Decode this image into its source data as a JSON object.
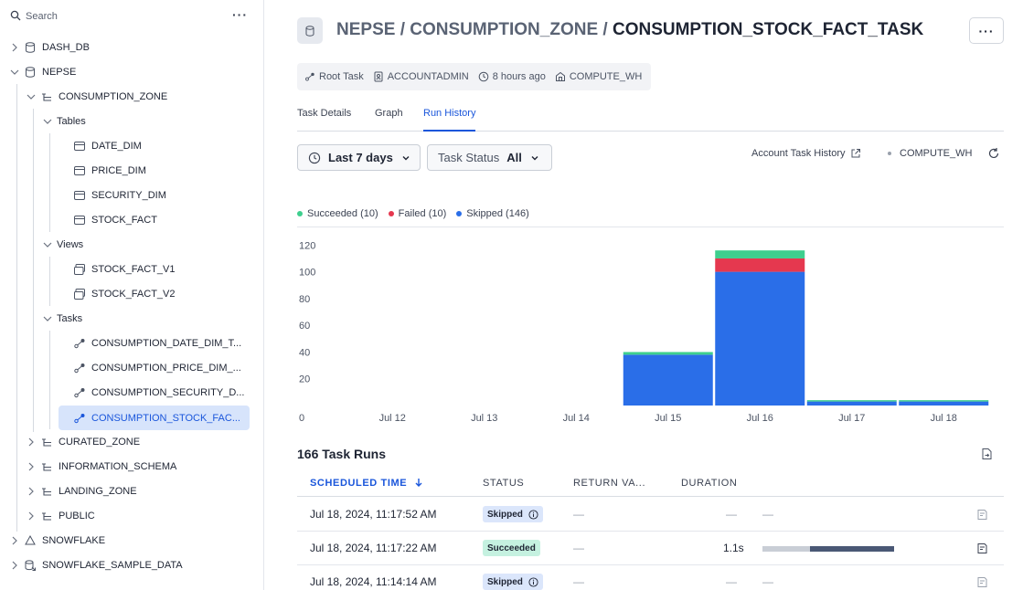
{
  "sidebar": {
    "search_placeholder": "Search",
    "more_label": "···",
    "items": [
      {
        "label": "DASH_DB"
      },
      {
        "label": "NEPSE"
      },
      {
        "label": "CONSUMPTION_ZONE"
      },
      {
        "label": "Tables"
      },
      {
        "label": "DATE_DIM"
      },
      {
        "label": "PRICE_DIM"
      },
      {
        "label": "SECURITY_DIM"
      },
      {
        "label": "STOCK_FACT"
      },
      {
        "label": "Views"
      },
      {
        "label": "STOCK_FACT_V1"
      },
      {
        "label": "STOCK_FACT_V2"
      },
      {
        "label": "Tasks"
      },
      {
        "label": "CONSUMPTION_DATE_DIM_T..."
      },
      {
        "label": "CONSUMPTION_PRICE_DIM_..."
      },
      {
        "label": "CONSUMPTION_SECURITY_D..."
      },
      {
        "label": "CONSUMPTION_STOCK_FAC..."
      },
      {
        "label": "CURATED_ZONE"
      },
      {
        "label": "INFORMATION_SCHEMA"
      },
      {
        "label": "LANDING_ZONE"
      },
      {
        "label": "PUBLIC"
      },
      {
        "label": "SNOWFLAKE"
      },
      {
        "label": "SNOWFLAKE_SAMPLE_DATA"
      }
    ]
  },
  "header": {
    "crumb1": "NEPSE",
    "sep": " / ",
    "crumb2": "CONSUMPTION_ZONE",
    "current": "CONSUMPTION_STOCK_FACT_TASK",
    "menu_label": "···"
  },
  "meta": {
    "type": "Root Task",
    "owner": "ACCOUNTADMIN",
    "time": "8 hours ago",
    "warehouse": "COMPUTE_WH"
  },
  "tabs": [
    "Task Details",
    "Graph",
    "Run History"
  ],
  "filters": {
    "range": "Last 7 days",
    "status_label": "Task Status",
    "status_value": "All"
  },
  "account_link": "Account Task History",
  "warehouse_label": "COMPUTE_WH",
  "legend": [
    {
      "label": "Succeeded (10)",
      "color": "#3ecf8e"
    },
    {
      "label": "Failed (10)",
      "color": "#e5384f"
    },
    {
      "label": "Skipped (146)",
      "color": "#2a6ee8"
    }
  ],
  "chart_data": {
    "type": "bar",
    "stacked": true,
    "categories": [
      "Jul 12",
      "Jul 13",
      "Jul 14",
      "Jul 15",
      "Jul 16",
      "Jul 17",
      "Jul 18"
    ],
    "series": [
      {
        "name": "Skipped",
        "color": "#2a6ee8",
        "values": [
          0,
          0,
          0,
          38,
          100,
          3,
          3
        ]
      },
      {
        "name": "Failed",
        "color": "#e5384f",
        "values": [
          0,
          0,
          0,
          0,
          10,
          0,
          0
        ]
      },
      {
        "name": "Succeeded",
        "color": "#3ecf8e",
        "values": [
          0,
          0,
          0,
          2,
          6,
          1,
          1
        ]
      }
    ],
    "yticks": [
      0,
      20,
      40,
      60,
      80,
      100,
      120
    ],
    "ylim": [
      0,
      120
    ],
    "grid": false,
    "legend_position": "top-left"
  },
  "runs": {
    "title": "166 Task Runs",
    "columns": [
      "SCHEDULED TIME",
      "STATUS",
      "RETURN VA...",
      "DURATION"
    ],
    "rows": [
      {
        "time": "Jul 18, 2024, 11:17:52 AM",
        "status": "Skipped",
        "return": "—",
        "duration": "—",
        "timeline": "—"
      },
      {
        "time": "Jul 18, 2024, 11:17:22 AM",
        "status": "Succeeded",
        "return": "—",
        "duration": "1.1s",
        "timeline": ""
      },
      {
        "time": "Jul 18, 2024, 11:14:14 AM",
        "status": "Skipped",
        "return": "—",
        "duration": "—",
        "timeline": "—"
      }
    ]
  }
}
